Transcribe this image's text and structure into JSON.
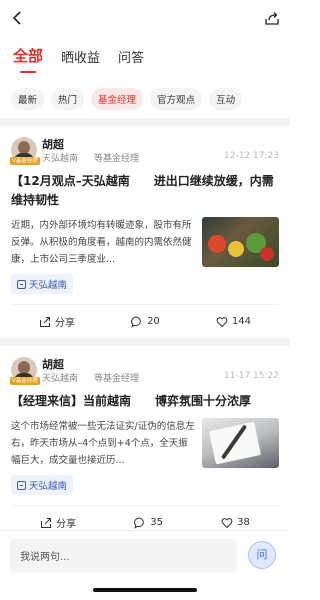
{
  "tabs": [
    {
      "label": "全部",
      "active": true
    },
    {
      "label": "晒收益",
      "active": false
    },
    {
      "label": "问答",
      "active": false
    }
  ],
  "chips": [
    {
      "label": "最新",
      "active": false
    },
    {
      "label": "热门",
      "active": false
    },
    {
      "label": "基金经理",
      "active": true
    },
    {
      "label": "官方观点",
      "active": false
    },
    {
      "label": "互动",
      "active": false
    }
  ],
  "posts": [
    {
      "author": "胡超",
      "badge": "V基金经理",
      "fund": "天弘越南",
      "role": "等基金经理",
      "time": "12-12 17:23",
      "title": "【12月观点–天弘越南　　进出口继续放缓，内需维持韧性",
      "excerpt": "近期，内外部环境均有转暖迹象，股市有所反弹。从积极的角度看，越南的内需依然健康，上市公司三季度业...",
      "tag": "天弘越南",
      "share": "分享",
      "comments": "20",
      "likes": "144"
    },
    {
      "author": "胡超",
      "badge": "V基金经理",
      "fund": "天弘越南",
      "role": "等基金经理",
      "time": "11-17 15:22",
      "title": "【经理来信】当前越南　　博弈氛围十分浓厚",
      "excerpt": "这个市场经常被一些无法证实/证伪的信息左右，昨天市场从–4个点到+4个点，全天振幅巨大，成交量也接近历...",
      "tag": "天弘越南",
      "share": "分享",
      "comments": "35",
      "likes": "38"
    }
  ],
  "bottom": {
    "placeholder": "我说两句...",
    "ask": "问"
  },
  "colors": {
    "accent": "#e0302b",
    "link": "#3a5aa8"
  }
}
